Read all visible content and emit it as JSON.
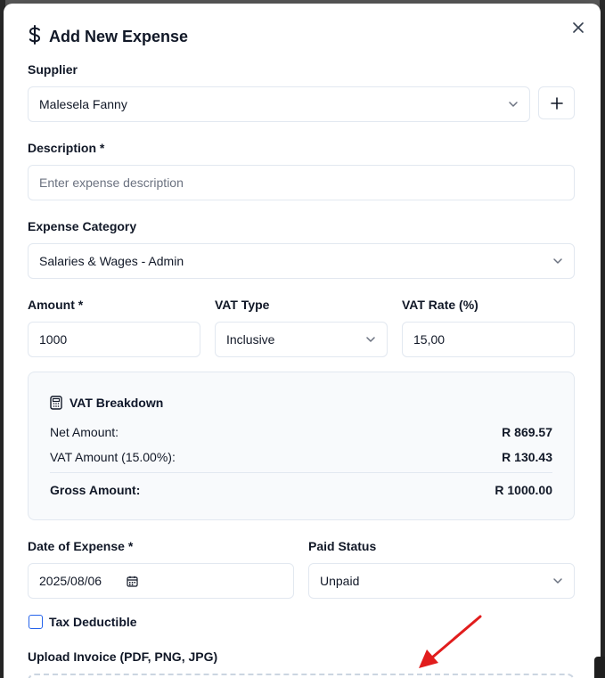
{
  "modal": {
    "title": "Add New Expense",
    "title_icon": "dollar-icon",
    "close_icon": "close-icon"
  },
  "form": {
    "supplier": {
      "label": "Supplier",
      "value": "Malesela Fanny",
      "add_icon": "plus-icon"
    },
    "description": {
      "label": "Description *",
      "placeholder": "Enter expense description",
      "value": ""
    },
    "category": {
      "label": "Expense Category",
      "value": "Salaries & Wages - Admin"
    },
    "amount": {
      "label": "Amount *",
      "value": "1000"
    },
    "vat_type": {
      "label": "VAT Type",
      "value": "Inclusive"
    },
    "vat_rate": {
      "label": "VAT Rate (%)",
      "value": "15,00"
    },
    "date": {
      "label": "Date of Expense *",
      "value": "2025/08/06"
    },
    "paid_status": {
      "label": "Paid Status",
      "value": "Unpaid"
    },
    "tax_deductible": {
      "label": "Tax Deductible",
      "checked": false
    },
    "upload": {
      "label": "Upload Invoice (PDF, PNG, JPG)"
    }
  },
  "vat_breakdown": {
    "title": "VAT Breakdown",
    "icon": "calculator-icon",
    "net_label": "Net Amount:",
    "net_value": "R 869.57",
    "vat_label": "VAT Amount (15.00%):",
    "vat_value": "R 130.43",
    "gross_label": "Gross Amount:",
    "gross_value": "R 1000.00"
  },
  "colors": {
    "accent": "#2563eb",
    "annotation_arrow": "#e11d1d",
    "border": "#e2e8f0",
    "panel_bg": "#f8fafc"
  }
}
